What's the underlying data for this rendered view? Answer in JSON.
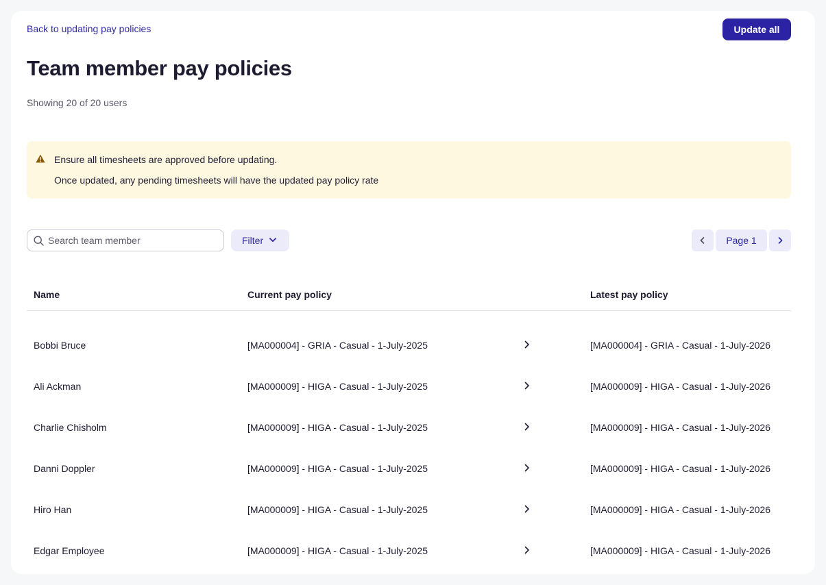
{
  "header": {
    "back_link": "Back to updating pay policies",
    "update_all_label": "Update all",
    "title": "Team member pay policies",
    "showing": "Showing 20 of 20 users"
  },
  "alert": {
    "icon": "warning-icon",
    "color": "#8a5a00",
    "line1": "Ensure all timesheets are approved before updating.",
    "line2": "Once updated, any pending timesheets will have the updated pay policy rate"
  },
  "toolbar": {
    "search_placeholder": "Search team member",
    "search_value": "",
    "filter_label": "Filter"
  },
  "pagination": {
    "page_label": "Page 1"
  },
  "table": {
    "columns": {
      "name": "Name",
      "current": "Current pay policy",
      "latest": "Latest pay policy"
    },
    "rows": [
      {
        "name": "Bobbi Bruce",
        "current": "[MA000004] - GRIA - Casual - 1-July-2025",
        "latest": "[MA000004] - GRIA - Casual - 1-July-2026"
      },
      {
        "name": "Ali Ackman",
        "current": "[MA000009] - HIGA - Casual - 1-July-2025",
        "latest": "[MA000009] - HIGA - Casual - 1-July-2026"
      },
      {
        "name": "Charlie Chisholm",
        "current": "[MA000009] - HIGA - Casual - 1-July-2025",
        "latest": "[MA000009] - HIGA - Casual - 1-July-2026"
      },
      {
        "name": "Danni Doppler",
        "current": "[MA000009] - HIGA - Casual - 1-July-2025",
        "latest": "[MA000009] - HIGA - Casual - 1-July-2026"
      },
      {
        "name": "Hiro Han",
        "current": "[MA000009] - HIGA - Casual - 1-July-2025",
        "latest": "[MA000009] - HIGA - Casual - 1-July-2026"
      },
      {
        "name": "Edgar Employee",
        "current": "[MA000009] - HIGA - Casual - 1-July-2025",
        "latest": "[MA000009] - HIGA - Casual - 1-July-2026"
      }
    ]
  },
  "colors": {
    "primary": "#2b23a3",
    "link": "#2f2aa3",
    "alert_bg": "#fff8e1",
    "secondary_bg": "#ecebfa"
  }
}
